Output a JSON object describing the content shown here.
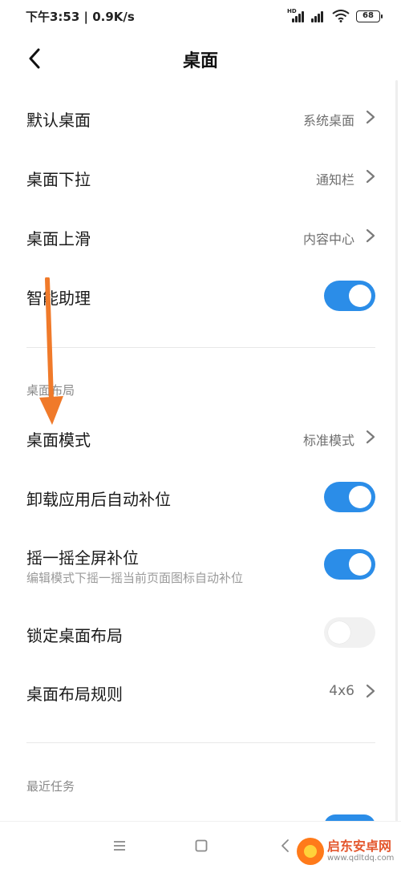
{
  "status_bar": {
    "time_speed": "下午3:53 | 0.9K/s",
    "signal_badge": "HD",
    "battery_level": "68"
  },
  "header": {
    "title": "桌面",
    "back_icon": "chevron-left-icon"
  },
  "rows": {
    "default_desktop": {
      "label": "默认桌面",
      "value": "系统桌面"
    },
    "pull_down": {
      "label": "桌面下拉",
      "value": "通知栏"
    },
    "swipe_up": {
      "label": "桌面上滑",
      "value": "内容中心"
    },
    "smart_assistant": {
      "label": "智能助理",
      "toggle_on": true
    },
    "desktop_mode": {
      "label": "桌面模式",
      "value": "标准模式"
    },
    "auto_fill": {
      "label": "卸载应用后自动补位",
      "toggle_on": true
    },
    "shake_fill": {
      "label": "摇一摇全屏补位",
      "sub": "编辑模式下摇一摇当前页面图标自动补位",
      "toggle_on": true
    },
    "lock_layout": {
      "label": "锁定桌面布局",
      "toggle_on": false
    },
    "layout_grid": {
      "label": "桌面布局规则",
      "value": "4x6"
    }
  },
  "sections": {
    "layout": "桌面布局",
    "recent": "最近任务"
  },
  "nav": {
    "menu_icon": "menu-icon",
    "home_icon": "home-square-icon",
    "back_icon": "back-triangle-icon"
  },
  "watermark": {
    "title": "启东安卓网",
    "url": "www.qdltdq.com"
  },
  "colors": {
    "accent": "#2b8de8",
    "annotation_arrow": "#f07a2a",
    "toggle_off": "#f1f1f1"
  }
}
